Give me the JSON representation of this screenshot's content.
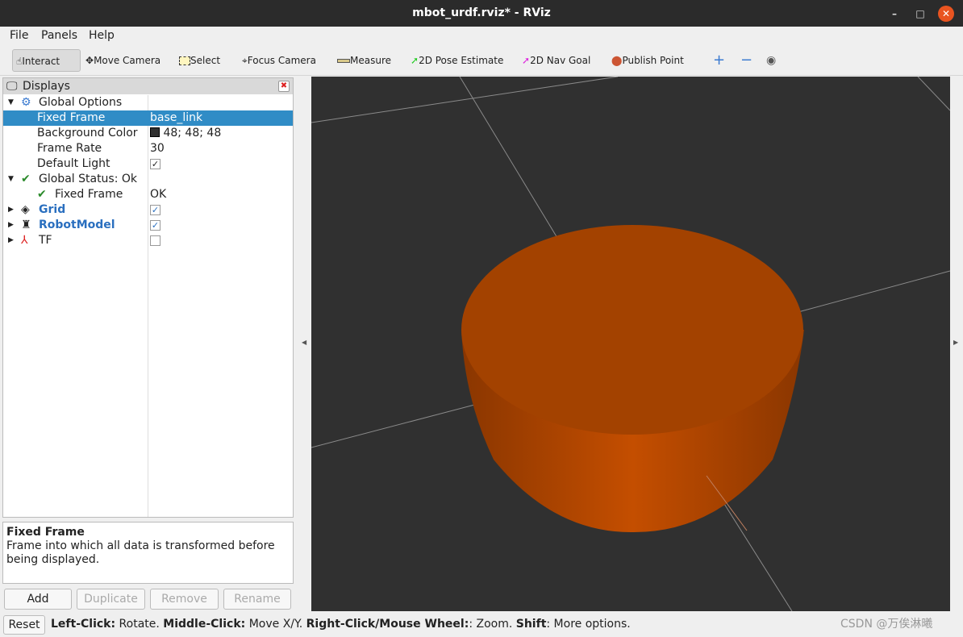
{
  "window": {
    "title": "mbot_urdf.rviz* - RViz",
    "minimize": "–",
    "maximize": "□",
    "close": "✕"
  },
  "menu": [
    "File",
    "Panels",
    "Help"
  ],
  "toolbar": [
    "Interact",
    "Move Camera",
    "Select",
    "Focus Camera",
    "Measure",
    "2D Pose Estimate",
    "2D Nav Goal",
    "Publish Point"
  ],
  "displays": {
    "title": "Displays",
    "rows": [
      {
        "label": "Global Options",
        "value": ""
      },
      {
        "label": "Fixed Frame",
        "value": "base_link"
      },
      {
        "label": "Background Color",
        "value": "48; 48; 48"
      },
      {
        "label": "Frame Rate",
        "value": "30"
      },
      {
        "label": "Default Light",
        "value": "✓"
      },
      {
        "label": "Global Status: Ok",
        "value": ""
      },
      {
        "label": "Fixed Frame",
        "value": "OK"
      },
      {
        "label": "Grid",
        "value": "✓"
      },
      {
        "label": "RobotModel",
        "value": "✓"
      },
      {
        "label": "TF",
        "value": ""
      }
    ]
  },
  "description": {
    "title": "Fixed Frame",
    "text": "Frame into which all data is transformed before being displayed."
  },
  "buttons": {
    "add": "Add",
    "duplicate": "Duplicate",
    "remove": "Remove",
    "rename": "Rename"
  },
  "status": {
    "reset": "Reset",
    "k1": "Left-Click:",
    "v1": " Rotate. ",
    "k2": "Middle-Click:",
    "v2": " Move X/Y. ",
    "k3": "Right-Click/Mouse Wheel:",
    "v3": ": Zoom. ",
    "k4": "Shift",
    "v4": ": More options."
  },
  "watermark": "CSDN @万俟淋曦",
  "colors": {
    "background": "#303030",
    "model": "#b34700",
    "selection": "#308cc6"
  }
}
